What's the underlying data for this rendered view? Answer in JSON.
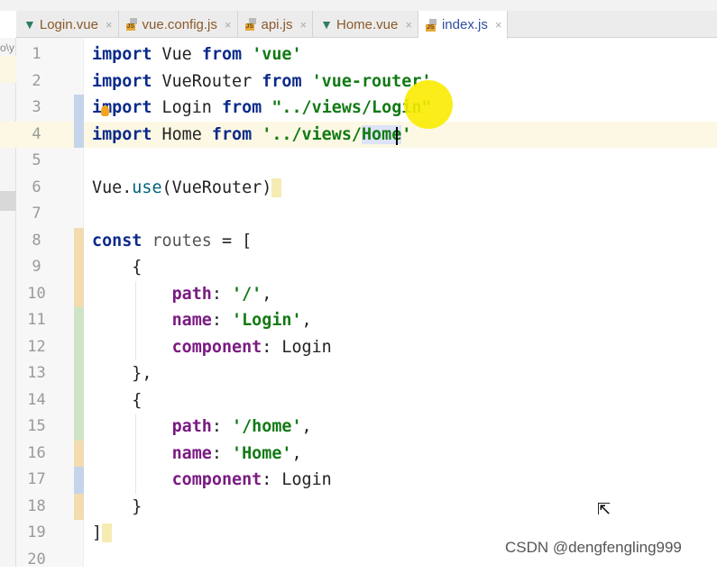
{
  "tabs": [
    {
      "label": "Login.vue",
      "icon": "vue-icon",
      "active": false
    },
    {
      "label": "vue.config.js",
      "icon": "js-file-icon",
      "active": false
    },
    {
      "label": "api.js",
      "icon": "js-file-icon",
      "active": false
    },
    {
      "label": "Home.vue",
      "icon": "vue-icon",
      "active": false
    },
    {
      "label": "index.js",
      "icon": "js-file-icon",
      "active": true
    }
  ],
  "left_panel_fragment": "o\\y",
  "editor": {
    "current_line": 4,
    "lines": [
      {
        "n": "1",
        "mark": "",
        "tokens": [
          [
            "kw",
            "import"
          ],
          [
            "id",
            " Vue "
          ],
          [
            "kw",
            "from"
          ],
          [
            "id",
            " "
          ],
          [
            "str",
            "'vue'"
          ]
        ]
      },
      {
        "n": "2",
        "mark": "",
        "tokens": [
          [
            "kw",
            "import"
          ],
          [
            "id",
            " VueRouter "
          ],
          [
            "kw",
            "from"
          ],
          [
            "id",
            " "
          ],
          [
            "str",
            "'vue-router'"
          ]
        ]
      },
      {
        "n": "3",
        "mark": "#c4d4ea",
        "tokens": [
          [
            "kw",
            "import"
          ],
          [
            "id",
            " Login "
          ],
          [
            "kw",
            "from"
          ],
          [
            "id",
            " "
          ],
          [
            "str",
            "\"../views/Login\""
          ]
        ]
      },
      {
        "n": "4",
        "mark": "#c4d4ea",
        "tokens": [
          [
            "kw",
            "import"
          ],
          [
            "id",
            " Home "
          ],
          [
            "kw",
            "from"
          ],
          [
            "id",
            " "
          ],
          [
            "str",
            "'../views/"
          ],
          [
            "str hlw",
            "Home"
          ],
          [
            "str",
            "'"
          ]
        ]
      },
      {
        "n": "5",
        "mark": "",
        "tokens": []
      },
      {
        "n": "6",
        "mark": "",
        "tokens": [
          [
            "id",
            "Vue."
          ],
          [
            "fn",
            "use"
          ],
          [
            "id",
            "(VueRouter)"
          ],
          [
            "brk",
            " "
          ]
        ]
      },
      {
        "n": "7",
        "mark": "",
        "tokens": []
      },
      {
        "n": "8",
        "mark": "#f2dcb0",
        "tokens": [
          [
            "kw",
            "const"
          ],
          [
            "var",
            " routes"
          ],
          [
            "pn",
            " = ["
          ]
        ]
      },
      {
        "n": "9",
        "mark": "#f2dcb0",
        "tokens": [
          [
            "pn",
            "    {"
          ]
        ]
      },
      {
        "n": "10",
        "mark": "#f2dcb0",
        "tokens": [
          [
            "pn",
            "        "
          ],
          [
            "prop",
            "path"
          ],
          [
            "pn",
            ": "
          ],
          [
            "str",
            "'/'"
          ],
          [
            "pn",
            ","
          ]
        ]
      },
      {
        "n": "11",
        "mark": "#cfe3c6",
        "tokens": [
          [
            "pn",
            "        "
          ],
          [
            "prop",
            "name"
          ],
          [
            "pn",
            ": "
          ],
          [
            "str",
            "'Login'"
          ],
          [
            "pn",
            ","
          ]
        ]
      },
      {
        "n": "12",
        "mark": "#cfe3c6",
        "tokens": [
          [
            "pn",
            "        "
          ],
          [
            "prop",
            "component"
          ],
          [
            "pn",
            ": "
          ],
          [
            "id",
            "Login"
          ]
        ]
      },
      {
        "n": "13",
        "mark": "#cfe3c6",
        "tokens": [
          [
            "pn",
            "    },"
          ]
        ]
      },
      {
        "n": "14",
        "mark": "#cfe3c6",
        "tokens": [
          [
            "pn",
            "    {"
          ]
        ]
      },
      {
        "n": "15",
        "mark": "#cfe3c6",
        "tokens": [
          [
            "pn",
            "        "
          ],
          [
            "prop",
            "path"
          ],
          [
            "pn",
            ": "
          ],
          [
            "str",
            "'/home'"
          ],
          [
            "pn",
            ","
          ]
        ]
      },
      {
        "n": "16",
        "mark": "#f2dcb0",
        "tokens": [
          [
            "pn",
            "        "
          ],
          [
            "prop",
            "name"
          ],
          [
            "pn",
            ": "
          ],
          [
            "str",
            "'Home'"
          ],
          [
            "pn",
            ","
          ]
        ]
      },
      {
        "n": "17",
        "mark": "#c4d4ea",
        "tokens": [
          [
            "pn",
            "        "
          ],
          [
            "prop",
            "component"
          ],
          [
            "pn",
            ": "
          ],
          [
            "id",
            "Login"
          ]
        ]
      },
      {
        "n": "18",
        "mark": "#f2dcb0",
        "tokens": [
          [
            "pn",
            "    }"
          ]
        ]
      },
      {
        "n": "19",
        "mark": "",
        "tokens": [
          [
            "pn",
            "]"
          ],
          [
            "brk",
            " "
          ]
        ]
      },
      {
        "n": "20",
        "mark": "",
        "tokens": []
      }
    ]
  },
  "watermark": "CSDN @dengfengling999"
}
